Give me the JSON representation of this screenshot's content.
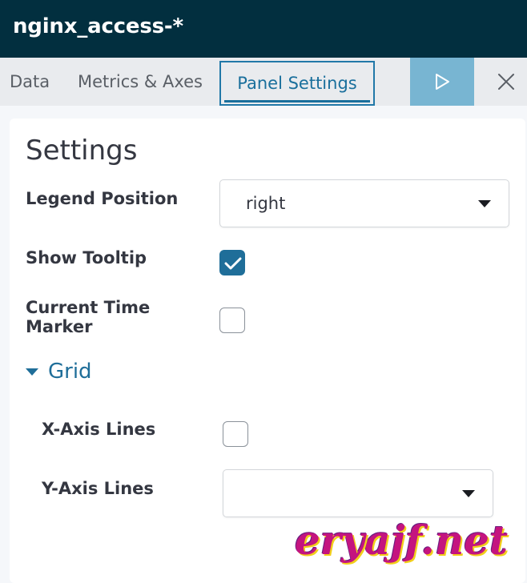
{
  "header": {
    "title": "nginx_access-*"
  },
  "tabs": [
    {
      "label": "Data"
    },
    {
      "label": "Metrics & Axes"
    },
    {
      "label": "Panel Settings",
      "active": true
    }
  ],
  "toolbar": {
    "run_icon": "play-icon",
    "close_icon": "close-icon"
  },
  "settings": {
    "title": "Settings",
    "legend_position": {
      "label": "Legend Position",
      "value": "right"
    },
    "show_tooltip": {
      "label": "Show Tooltip",
      "checked": true
    },
    "current_time_marker": {
      "label_line1": "Current Time",
      "label_line2": "Marker",
      "checked": false
    }
  },
  "grid": {
    "label": "Grid",
    "expanded": true,
    "x_axis_lines": {
      "label": "X-Axis Lines",
      "checked": false
    },
    "y_axis_lines": {
      "label": "Y-Axis Lines",
      "value": ""
    }
  },
  "watermark": {
    "text": "eryajf.net"
  },
  "colors": {
    "header_bg": "#022f3f",
    "accent": "#1f6e99",
    "run_button": "#78b5d2"
  }
}
